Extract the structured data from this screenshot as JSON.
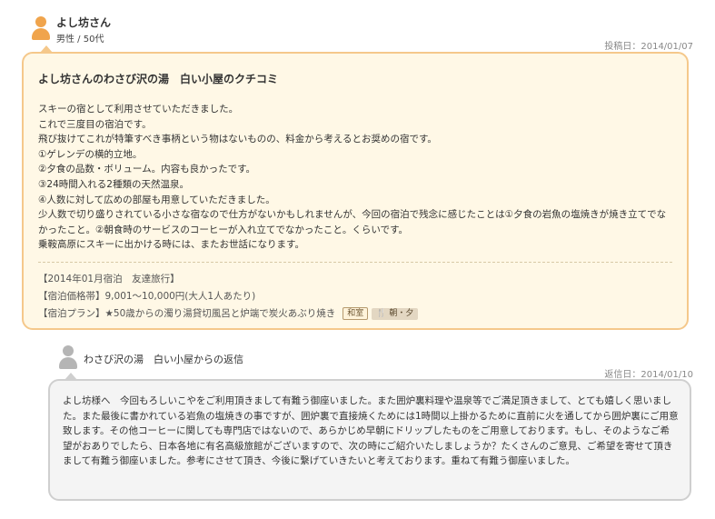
{
  "review": {
    "user_name": "よし坊さん",
    "user_meta": "男性 / 50代",
    "posted_date": "投稿日：2014/01/07",
    "title": "よし坊さんのわさび沢の湯　白い小屋のクチコミ",
    "body_lines": [
      "スキーの宿として利用させていただきました。",
      "これで三度目の宿泊です。",
      "飛び抜けてこれが特筆すべき事柄という物はないものの、料金から考えるとお奨めの宿です。",
      "①ゲレンデの横的立地。",
      "②夕食の品数・ボリューム。内容も良かったです。",
      "③24時間入れる2種類の天然温泉。",
      "④人数に対して広めの部屋も用意していただきました。",
      "少人数で切り盛りされている小さな宿なので仕方がないかもしれませんが、今回の宿泊で残念に感じたことは①夕食の岩魚の塩焼きが焼き立てでなかったこと。②朝食時のサービスのコーヒーが入れ立てでなかったこと。くらいです。",
      "乗鞍高原にスキーに出かける時には、またお世話になります。"
    ],
    "stay_info": "【2014年01月宿泊　友達旅行】",
    "price_info": "【宿泊価格帯】9,001～10,000円(大人1人あたり)",
    "plan_info": "【宿泊プラン】★50歳からの濁り湯貸切風呂と炉端で炭火あぶり焼き",
    "room_tag": "和室",
    "meal_tag": "🍴 朝・夕"
  },
  "reply": {
    "name": "わさび沢の湯　白い小屋からの返信",
    "date": "返信日：2014/01/10",
    "body": "よし坊様へ　今回もろしいこやをご利用頂きまして有難う御座いました。また囲炉裏料理や温泉等でご満足頂きまして、とても嬉しく思いました。また最後に書かれている岩魚の塩焼きの事ですが、囲炉裏で直接焼くためには1時間以上掛かるために直前に火を通してから囲炉裏にご用意致します。その他コーヒーに関しても専門店ではないので、あらかじめ早朝にドリップしたものをご用意しております。もし、そのようなご希望がおありでしたら、日本各地に有名高級旅館がございますので、次の時にご紹介いたしましょうか？たくさんのご意見、ご希望を寄せて頂きまして有難う御座いました。参考にさせて頂き、今後に繋げていきたいと考えております。重ねて有難う御座いました。"
  },
  "colors": {
    "review_bg": "#fff8e6",
    "review_border": "#f5c88b",
    "reply_bg": "#f4f4f4",
    "reply_border": "#cfcfcf",
    "avatar_user": "#f0a44c",
    "avatar_host": "#b5b5b5"
  }
}
